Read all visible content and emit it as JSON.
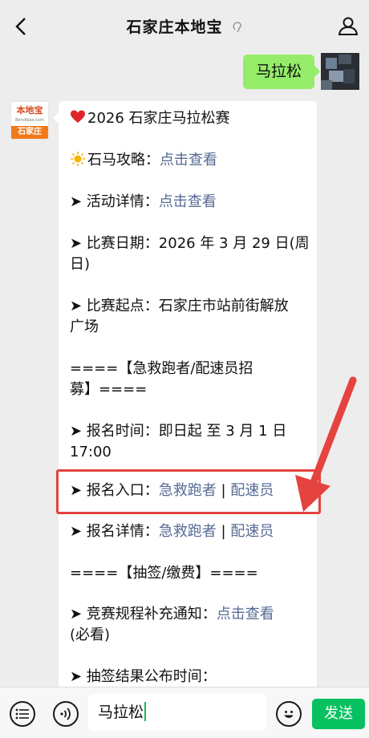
{
  "header": {
    "title": "石家庄本地宝"
  },
  "chat": {
    "my_message": "马拉松",
    "bot_avatar": {
      "brand": "本地宝",
      "site": "Bendibao.com",
      "city": "石家庄"
    },
    "bot_message": {
      "title": "2026 石家庄马拉松赛",
      "guide_label": "石马攻略：",
      "guide_link": "点击查看",
      "detail_label": "➤ 活动详情：",
      "detail_link": "点击查看",
      "date_line": "➤ 比赛日期：2026 年 3 月 29 日(周",
      "date_line_2": "日)",
      "start_line": "➤ 比赛起点：石家庄市站前街解放",
      "start_line_2": "广场",
      "recruit_line": "====【急救跑者/配速员招",
      "recruit_line_2": "募】====",
      "signup_time_line": "➤ 报名时间：即日起 至 3 月 1 日",
      "signup_time_line_2": "17:00",
      "entry_label": "➤ 报名入口：",
      "entry_link_1": "急救跑者",
      "entry_sep": " | ",
      "entry_link_2": "配速员",
      "signup_detail_label": "➤ 报名详情：",
      "signup_detail_link_1": "急救跑者",
      "signup_detail_sep": " | ",
      "signup_detail_link_2": "配速员",
      "lottery_section": "====【抽签/缴费】====",
      "rules_label": "➤ 竞赛规程补充通知：",
      "rules_link": "点击查看",
      "rules_note": "(必看)",
      "lottery_result_label": "➤ 抽签结果公布时间："
    }
  },
  "inputbar": {
    "input_value": "马拉松",
    "send_label": "发送"
  },
  "colors": {
    "accent_green": "#07c160",
    "bubble_green": "#95ec69",
    "link_blue": "#576b95",
    "highlight_red": "#e5433f"
  }
}
